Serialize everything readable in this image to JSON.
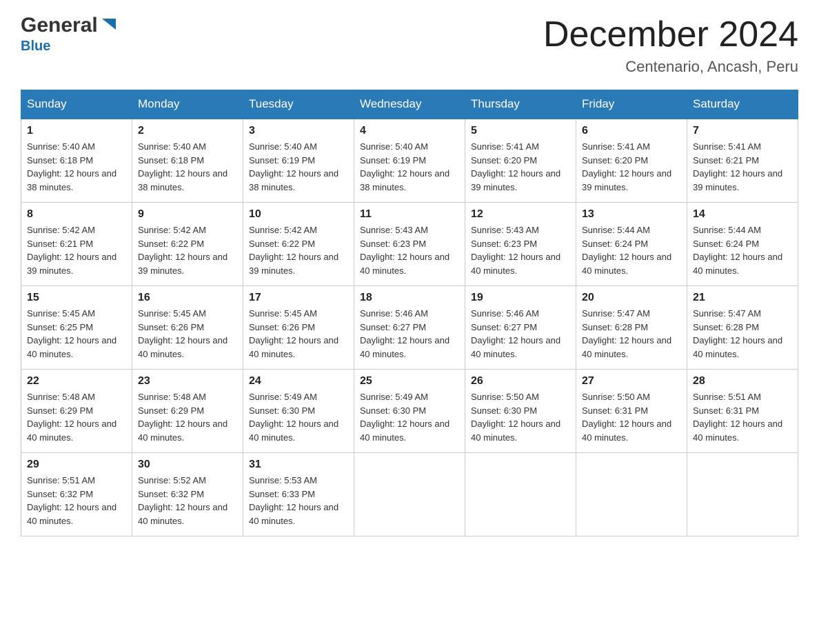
{
  "header": {
    "logo_general": "General",
    "logo_blue": "Blue",
    "month_title": "December 2024",
    "location": "Centenario, Ancash, Peru"
  },
  "days_of_week": [
    "Sunday",
    "Monday",
    "Tuesday",
    "Wednesday",
    "Thursday",
    "Friday",
    "Saturday"
  ],
  "weeks": [
    [
      {
        "day": "1",
        "sunrise": "5:40 AM",
        "sunset": "6:18 PM",
        "daylight": "12 hours and 38 minutes."
      },
      {
        "day": "2",
        "sunrise": "5:40 AM",
        "sunset": "6:18 PM",
        "daylight": "12 hours and 38 minutes."
      },
      {
        "day": "3",
        "sunrise": "5:40 AM",
        "sunset": "6:19 PM",
        "daylight": "12 hours and 38 minutes."
      },
      {
        "day": "4",
        "sunrise": "5:40 AM",
        "sunset": "6:19 PM",
        "daylight": "12 hours and 38 minutes."
      },
      {
        "day": "5",
        "sunrise": "5:41 AM",
        "sunset": "6:20 PM",
        "daylight": "12 hours and 39 minutes."
      },
      {
        "day": "6",
        "sunrise": "5:41 AM",
        "sunset": "6:20 PM",
        "daylight": "12 hours and 39 minutes."
      },
      {
        "day": "7",
        "sunrise": "5:41 AM",
        "sunset": "6:21 PM",
        "daylight": "12 hours and 39 minutes."
      }
    ],
    [
      {
        "day": "8",
        "sunrise": "5:42 AM",
        "sunset": "6:21 PM",
        "daylight": "12 hours and 39 minutes."
      },
      {
        "day": "9",
        "sunrise": "5:42 AM",
        "sunset": "6:22 PM",
        "daylight": "12 hours and 39 minutes."
      },
      {
        "day": "10",
        "sunrise": "5:42 AM",
        "sunset": "6:22 PM",
        "daylight": "12 hours and 39 minutes."
      },
      {
        "day": "11",
        "sunrise": "5:43 AM",
        "sunset": "6:23 PM",
        "daylight": "12 hours and 40 minutes."
      },
      {
        "day": "12",
        "sunrise": "5:43 AM",
        "sunset": "6:23 PM",
        "daylight": "12 hours and 40 minutes."
      },
      {
        "day": "13",
        "sunrise": "5:44 AM",
        "sunset": "6:24 PM",
        "daylight": "12 hours and 40 minutes."
      },
      {
        "day": "14",
        "sunrise": "5:44 AM",
        "sunset": "6:24 PM",
        "daylight": "12 hours and 40 minutes."
      }
    ],
    [
      {
        "day": "15",
        "sunrise": "5:45 AM",
        "sunset": "6:25 PM",
        "daylight": "12 hours and 40 minutes."
      },
      {
        "day": "16",
        "sunrise": "5:45 AM",
        "sunset": "6:26 PM",
        "daylight": "12 hours and 40 minutes."
      },
      {
        "day": "17",
        "sunrise": "5:45 AM",
        "sunset": "6:26 PM",
        "daylight": "12 hours and 40 minutes."
      },
      {
        "day": "18",
        "sunrise": "5:46 AM",
        "sunset": "6:27 PM",
        "daylight": "12 hours and 40 minutes."
      },
      {
        "day": "19",
        "sunrise": "5:46 AM",
        "sunset": "6:27 PM",
        "daylight": "12 hours and 40 minutes."
      },
      {
        "day": "20",
        "sunrise": "5:47 AM",
        "sunset": "6:28 PM",
        "daylight": "12 hours and 40 minutes."
      },
      {
        "day": "21",
        "sunrise": "5:47 AM",
        "sunset": "6:28 PM",
        "daylight": "12 hours and 40 minutes."
      }
    ],
    [
      {
        "day": "22",
        "sunrise": "5:48 AM",
        "sunset": "6:29 PM",
        "daylight": "12 hours and 40 minutes."
      },
      {
        "day": "23",
        "sunrise": "5:48 AM",
        "sunset": "6:29 PM",
        "daylight": "12 hours and 40 minutes."
      },
      {
        "day": "24",
        "sunrise": "5:49 AM",
        "sunset": "6:30 PM",
        "daylight": "12 hours and 40 minutes."
      },
      {
        "day": "25",
        "sunrise": "5:49 AM",
        "sunset": "6:30 PM",
        "daylight": "12 hours and 40 minutes."
      },
      {
        "day": "26",
        "sunrise": "5:50 AM",
        "sunset": "6:30 PM",
        "daylight": "12 hours and 40 minutes."
      },
      {
        "day": "27",
        "sunrise": "5:50 AM",
        "sunset": "6:31 PM",
        "daylight": "12 hours and 40 minutes."
      },
      {
        "day": "28",
        "sunrise": "5:51 AM",
        "sunset": "6:31 PM",
        "daylight": "12 hours and 40 minutes."
      }
    ],
    [
      {
        "day": "29",
        "sunrise": "5:51 AM",
        "sunset": "6:32 PM",
        "daylight": "12 hours and 40 minutes."
      },
      {
        "day": "30",
        "sunrise": "5:52 AM",
        "sunset": "6:32 PM",
        "daylight": "12 hours and 40 minutes."
      },
      {
        "day": "31",
        "sunrise": "5:53 AM",
        "sunset": "6:33 PM",
        "daylight": "12 hours and 40 minutes."
      },
      null,
      null,
      null,
      null
    ]
  ]
}
